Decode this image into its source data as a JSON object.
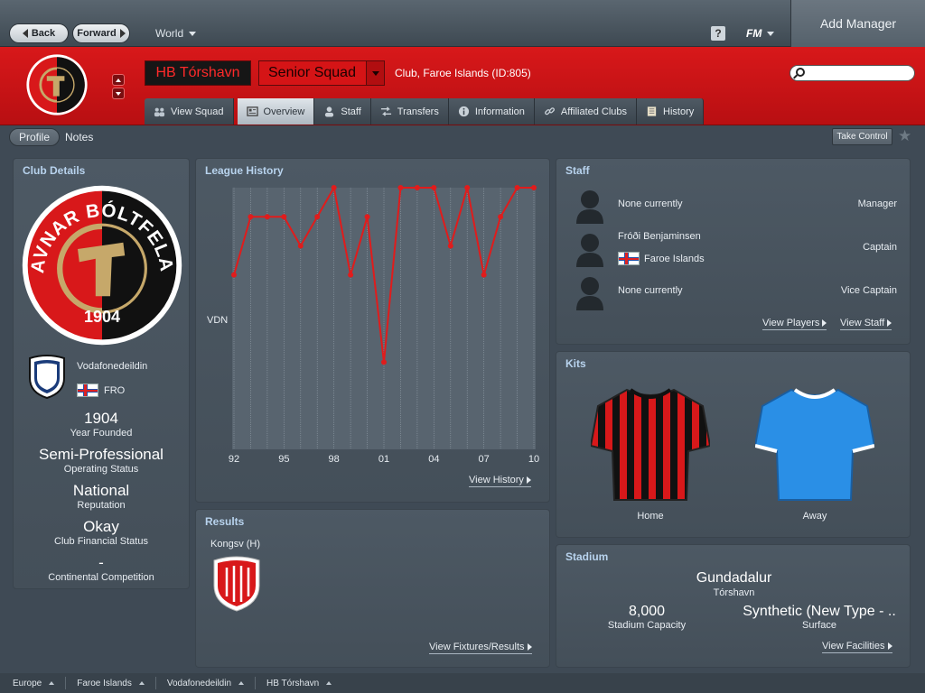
{
  "nav": {
    "back": "Back",
    "forward": "Forward",
    "world": "World",
    "help": "?",
    "fm": "FM",
    "add_manager": "Add Manager"
  },
  "club": {
    "name": "HB Tórshavn",
    "squad": "Senior Squad",
    "info": "Club, Faroe Islands (ID:805)",
    "crest_text_top": "HAVNAR BÓLTFELAG",
    "crest_year": "1904"
  },
  "search": {
    "placeholder": ""
  },
  "tabs": [
    {
      "label": "View Squad",
      "icon": "people-icon"
    },
    {
      "label": "Overview",
      "icon": "overview-icon"
    },
    {
      "label": "Staff",
      "icon": "person-icon"
    },
    {
      "label": "Transfers",
      "icon": "transfer-arrows-icon"
    },
    {
      "label": "Information",
      "icon": "info-icon"
    },
    {
      "label": "Affiliated Clubs",
      "icon": "link-icon"
    },
    {
      "label": "History",
      "icon": "book-icon"
    }
  ],
  "subnav": {
    "profile": "Profile",
    "notes": "Notes",
    "take_control": "Take Control"
  },
  "club_details": {
    "title": "Club Details",
    "division": "Vodafonedeildin",
    "nation": "FRO",
    "year": "1904",
    "year_label": "Year Founded",
    "status": "Semi-Professional",
    "status_label": "Operating Status",
    "reputation": "National",
    "reputation_label": "Reputation",
    "finance": "Okay",
    "finance_label": "Club Financial Status",
    "continental": "-",
    "continental_label": "Continental Competition"
  },
  "league_history": {
    "title": "League History",
    "view_link": "View History"
  },
  "chart_data": {
    "type": "line",
    "title": "League History",
    "ylabel": "VDN",
    "x": [
      1992,
      1993,
      1994,
      1995,
      1996,
      1997,
      1998,
      1999,
      2000,
      2001,
      2002,
      2003,
      2004,
      2005,
      2006,
      2007,
      2008,
      2009,
      2010
    ],
    "tick_labels": [
      "92",
      "95",
      "98",
      "01",
      "04",
      "07",
      "10"
    ],
    "tick_years": [
      1992,
      1995,
      1998,
      2001,
      2004,
      2007,
      2010
    ],
    "y_positions": [
      4,
      2,
      2,
      2,
      3,
      2,
      1,
      4,
      2,
      7,
      1,
      1,
      1,
      3,
      1,
      4,
      2,
      1,
      1
    ],
    "ylim": [
      1,
      10
    ],
    "y_inverted": true,
    "color": "#e01c1c"
  },
  "results": {
    "title": "Results",
    "opponent": "Kongsv (H)",
    "view_link": "View Fixtures/Results"
  },
  "staff": {
    "title": "Staff",
    "rows": [
      {
        "name": "None currently",
        "role": "Manager",
        "nation": ""
      },
      {
        "name": "Fróði Benjaminsen",
        "role": "Captain",
        "nation": "Faroe Islands"
      },
      {
        "name": "None currently",
        "role": "Vice Captain",
        "nation": ""
      }
    ],
    "view_players": "View Players",
    "view_staff": "View Staff"
  },
  "kits": {
    "title": "Kits",
    "home": "Home",
    "away": "Away"
  },
  "stadium": {
    "title": "Stadium",
    "name": "Gundadalur",
    "city": "Tórshavn",
    "capacity": "8,000",
    "capacity_label": "Stadium Capacity",
    "surface": "Synthetic (New Type - ..",
    "surface_label": "Surface",
    "view_link": "View Facilities"
  },
  "footer": [
    "Europe",
    "Faroe Islands",
    "Vodafonedeildin",
    "HB Tórshavn"
  ],
  "colors": {
    "club_red": "#d8181a",
    "accent_blue": "#b8d3ee",
    "chart_line": "#e01c1c"
  }
}
